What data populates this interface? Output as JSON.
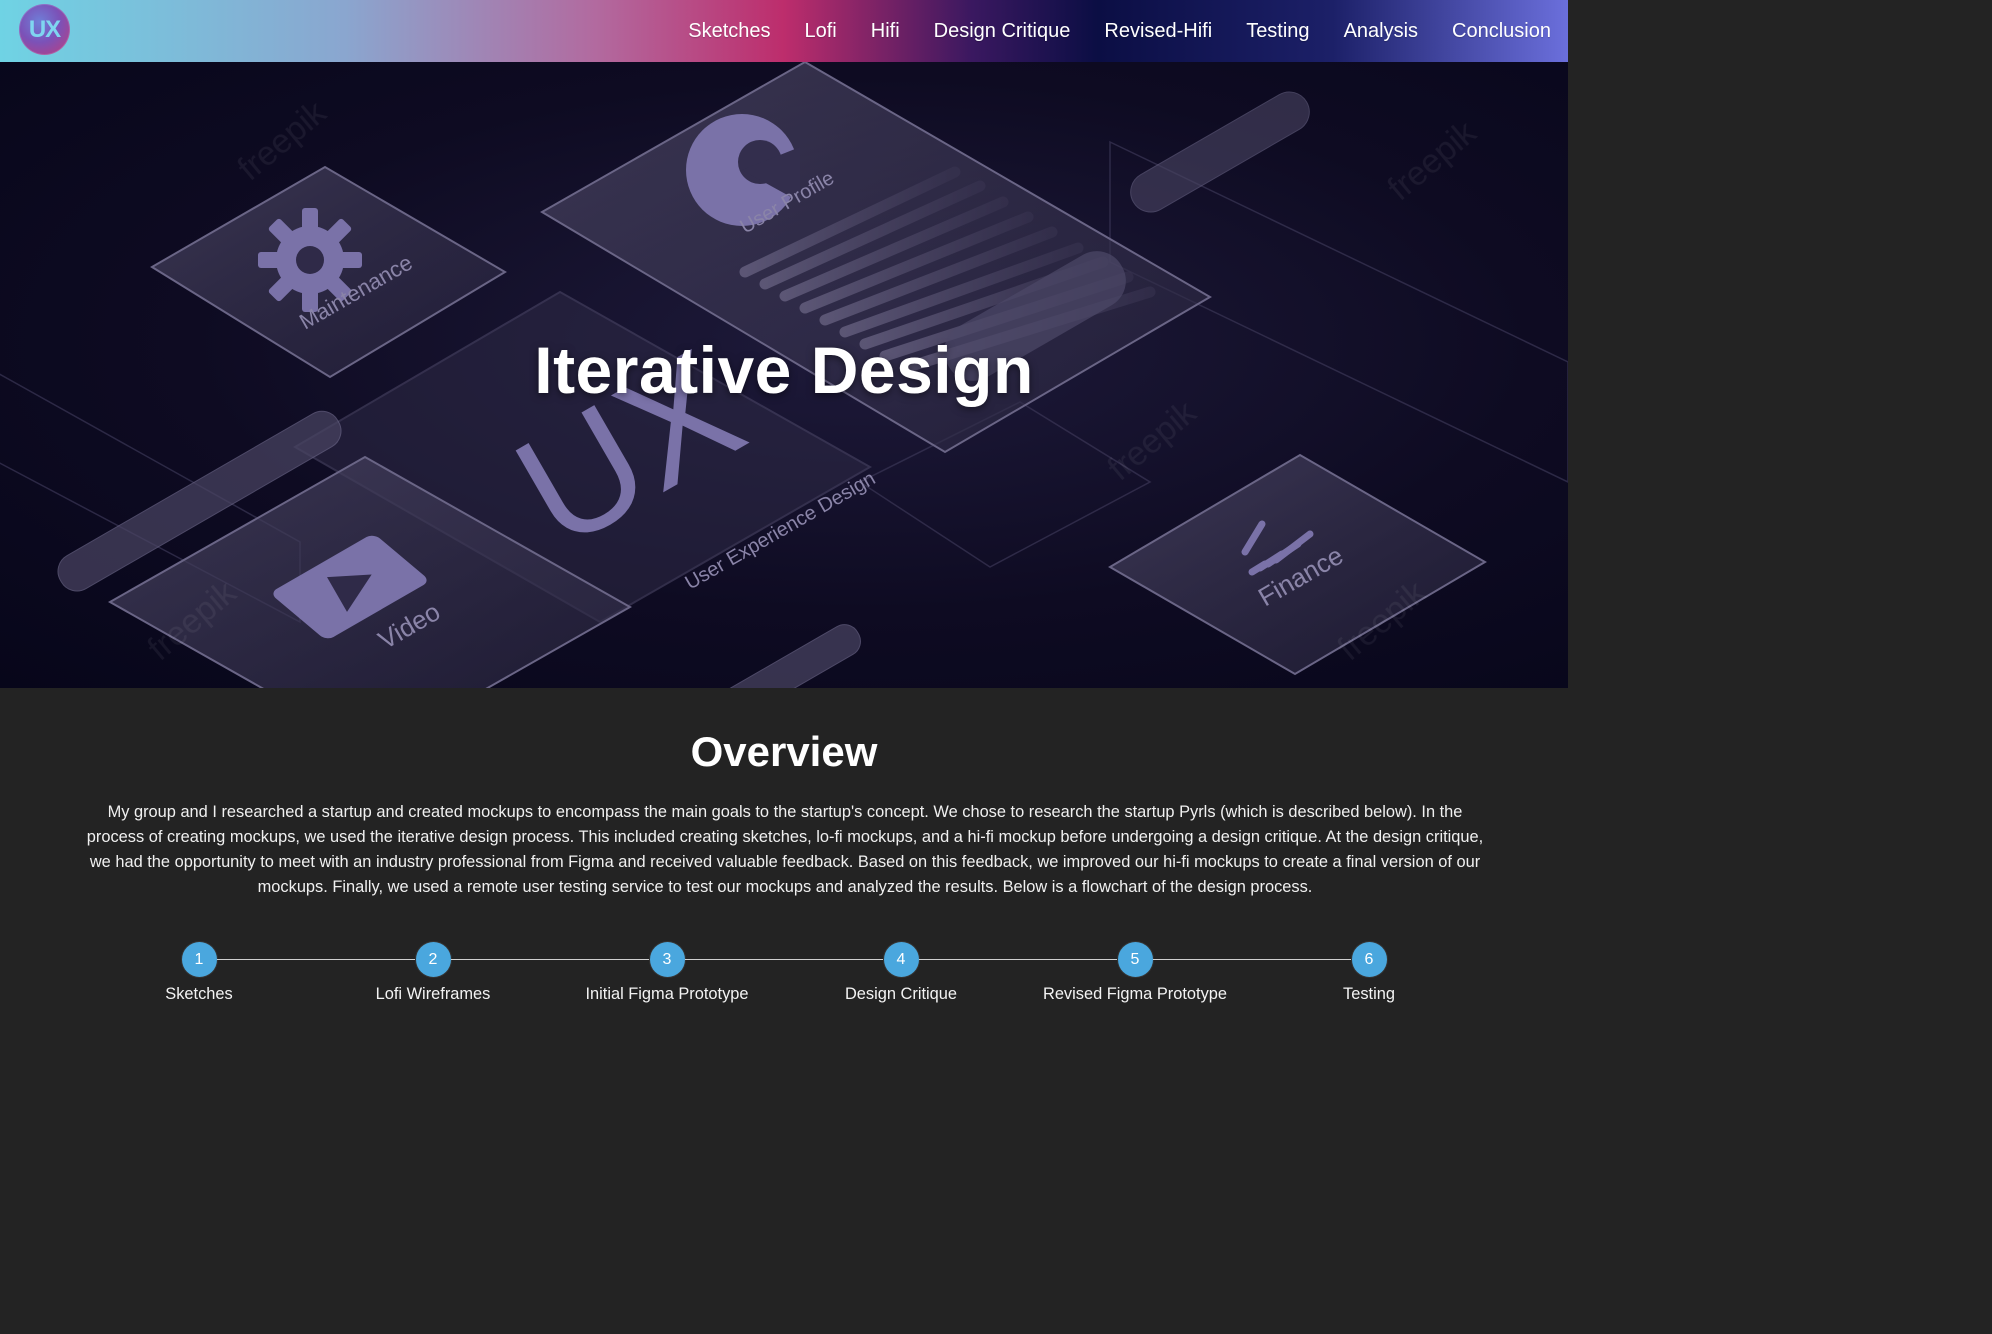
{
  "nav": {
    "logo_text": "UX",
    "links": [
      "Sketches",
      "Lofi",
      "Hifi",
      "Design Critique",
      "Revised-Hifi",
      "Testing",
      "Analysis",
      "Conclusion"
    ]
  },
  "hero": {
    "title": "Iterative Design",
    "illustration_labels": [
      "Maintenance",
      "User Profile",
      "UX",
      "User Experience Design",
      "Video",
      "Finance"
    ],
    "watermark": "freepik"
  },
  "overview": {
    "title": "Overview",
    "text": "My group and I researched a startup and created mockups to encompass the main goals to the startup's concept. We chose to research the startup Pyrls (which is described below). In the process of creating mockups, we used the iterative design process. This included creating sketches, lo-fi mockups, and a hi-fi mockup before undergoing a design critique. At the design critique, we had the opportunity to meet with an industry professional from Figma and received valuable feedback. Based on this feedback, we improved our hi-fi mockups to create a final version of our mockups. Finally, we used a remote user testing service to test our mockups and analyzed the results. Below is a flowchart of the design process."
  },
  "flow": {
    "steps": [
      {
        "number": "1",
        "label": "Sketches"
      },
      {
        "number": "2",
        "label": "Lofi Wireframes"
      },
      {
        "number": "3",
        "label": "Initial Figma Prototype"
      },
      {
        "number": "4",
        "label": "Design Critique"
      },
      {
        "number": "5",
        "label": "Revised Figma Prototype"
      },
      {
        "number": "6",
        "label": "Testing"
      }
    ],
    "accent_color": "#4aa7de"
  }
}
